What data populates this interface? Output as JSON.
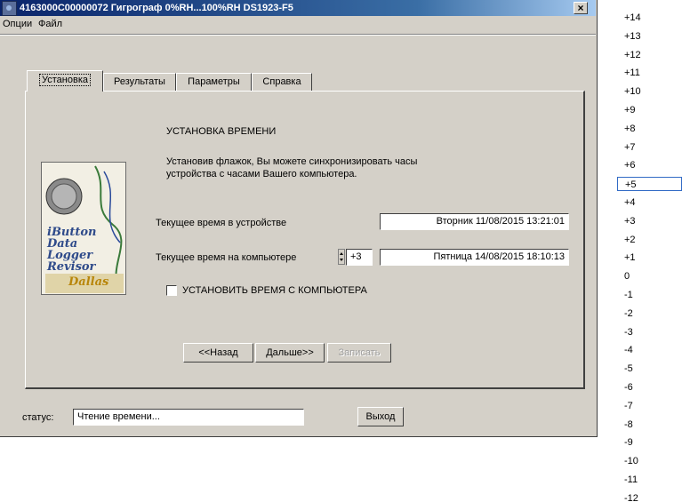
{
  "window": {
    "title": "4163000C00000072   Гигрограф 0%RH...100%RH   DS1923-F5",
    "close_label": "×"
  },
  "menu": [
    "Опции",
    "Файл"
  ],
  "tabs": [
    {
      "label": "Установка",
      "active": true
    },
    {
      "label": "Результаты",
      "active": false
    },
    {
      "label": "Параметры",
      "active": false
    },
    {
      "label": "Справка",
      "active": false
    }
  ],
  "logo": {
    "lines": [
      "iButton",
      "Data",
      "Logger",
      "Revisor",
      "Dallas"
    ]
  },
  "setup": {
    "heading": "УСТАНОВКА ВРЕМЕНИ",
    "description_line1": "Установив флажок, Вы можете синхронизировать часы",
    "description_line2": "устройства с часами Вашего компьютера.",
    "device_time_label": "Текущее время  в устройстве",
    "device_time_value": "Вторник 11/08/2015 13:21:01",
    "pc_time_label": "Текущее время  на компьютере",
    "offset_value": "+3",
    "pc_time_value": "Пятница 14/08/2015 18:10:13",
    "sync_checkbox_label": "УСТАНОВИТЬ ВРЕМЯ С КОМПЬЮТЕРА",
    "sync_checked": false
  },
  "nav": {
    "back": "<<Назад",
    "next": "Дальше>>",
    "write": "Записать"
  },
  "status": {
    "label": "статус:",
    "value": "Чтение времени...",
    "exit": "Выход"
  },
  "offset_list": {
    "items": [
      "+14",
      "+13",
      "+12",
      "+11",
      "+10",
      "+9",
      "+8",
      "+7",
      "+6",
      "+5",
      "+4",
      "+3",
      "+2",
      "+1",
      "0",
      "-1",
      "-2",
      "-3",
      "-4",
      "-5",
      "-6",
      "-7",
      "-8",
      "-9",
      "-10",
      "-11",
      "-12"
    ],
    "selected": "+5"
  }
}
